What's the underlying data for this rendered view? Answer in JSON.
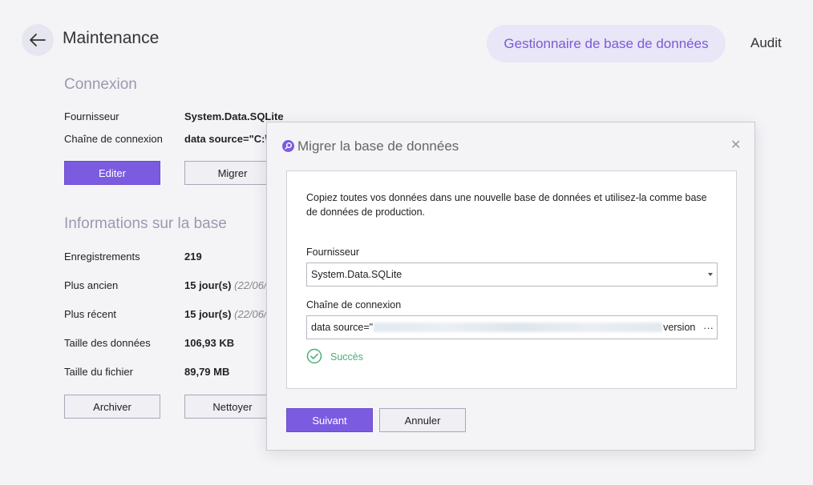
{
  "header": {
    "title": "Maintenance",
    "tabs": [
      {
        "label": "Gestionnaire de base de données",
        "active": true
      },
      {
        "label": "Audit",
        "active": false
      }
    ]
  },
  "connection": {
    "section_title": "Connexion",
    "provider_label": "Fournisseur",
    "provider_value": "System.Data.SQLite",
    "conn_string_label": "Chaîne de connexion",
    "conn_string_value": "data source=\"C:\\",
    "edit_button": "Editer",
    "migrate_button": "Migrer"
  },
  "db_info": {
    "section_title": "Informations sur la base",
    "rows": [
      {
        "label": "Enregistrements",
        "value": "219",
        "note": ""
      },
      {
        "label": "Plus ancien",
        "value": "15 jour(s)",
        "note": "(22/06/"
      },
      {
        "label": "Plus récent",
        "value": "15 jour(s)",
        "note": "(22/06/"
      },
      {
        "label": "Taille des données",
        "value": "106,93 KB",
        "note": ""
      },
      {
        "label": "Taille du fichier",
        "value": "89,79 MB",
        "note": ""
      }
    ],
    "archive_button": "Archiver",
    "clean_button": "Nettoyer"
  },
  "dialog": {
    "title": "Migrer la base de données",
    "description": "Copiez toutes vos données dans une nouvelle base de données et utilisez-la comme base de données de production.",
    "provider_label": "Fournisseur",
    "provider_selected": "System.Data.SQLite",
    "conn_label": "Chaîne de connexion",
    "conn_prefix": "data source=\"",
    "conn_suffix": "version",
    "more_label": "···",
    "status_text": "Succès",
    "next_button": "Suivant",
    "cancel_button": "Annuler"
  },
  "colors": {
    "accent": "#7b5ce0",
    "accent_soft": "#e8e6f7",
    "success": "#4caf7a",
    "background": "#f4f4f7"
  }
}
